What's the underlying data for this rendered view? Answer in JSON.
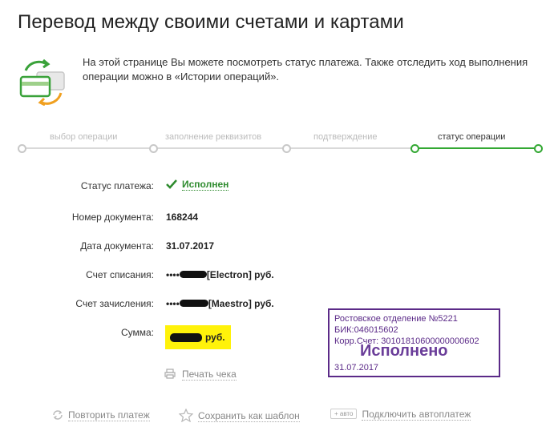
{
  "page": {
    "title": "Перевод между своими счетами и картами",
    "intro": "На этой странице Вы можете посмотреть статус платежа. Также отследить ход выполнения операции можно в «Истории операций»."
  },
  "steps": [
    {
      "label": "выбор операции",
      "state": "done"
    },
    {
      "label": "заполнение реквизитов",
      "state": "done"
    },
    {
      "label": "подтверждение",
      "state": "done"
    },
    {
      "label": "статус операции",
      "state": "current"
    }
  ],
  "details": {
    "status": {
      "label": "Статус платежа:",
      "value": "Исполнен"
    },
    "doc_number": {
      "label": "Номер документа:",
      "value": "168244"
    },
    "doc_date": {
      "label": "Дата документа:",
      "value": "31.07.2017"
    },
    "debit": {
      "label": "Счет списания:",
      "prefix": "••••",
      "card_type": "[Electron]",
      "currency": "руб."
    },
    "credit": {
      "label": "Счет зачисления:",
      "prefix": "••••",
      "card_type": "[Maestro]",
      "currency": "руб."
    },
    "sum": {
      "label": "Сумма:",
      "currency": "руб."
    }
  },
  "print_label": "Печать чека",
  "stamp": {
    "line1": "Ростовское отделение №5221",
    "line2": "БИК:046015602",
    "line3": "Корр.Счет: 30101810600000000602",
    "status": "Исполнено",
    "date": "31.07.2017"
  },
  "actions": {
    "repeat": "Повторить платеж",
    "save_template": "Сохранить как шаблон",
    "auto_badge": "+ авто",
    "autopay": "Подключить автоплатеж"
  },
  "colors": {
    "accent_green": "#33a833",
    "stamp_purple": "#5b2a88",
    "highlight_yellow": "#fff20a"
  }
}
